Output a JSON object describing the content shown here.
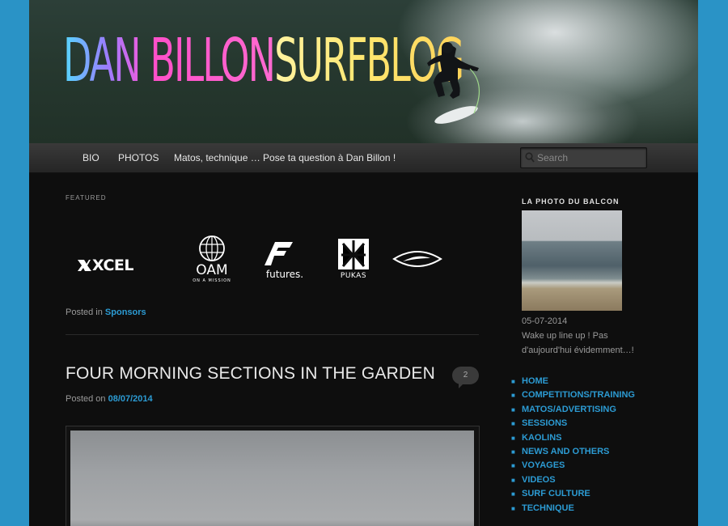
{
  "header": {
    "title_part1": "DAN BILLON",
    "title_part2": " ",
    "title_part3": "SURFBLOG"
  },
  "nav": {
    "items": [
      {
        "label": "BIO"
      },
      {
        "label": "PHOTOS"
      },
      {
        "label": "Matos, technique … Pose ta question à Dan Billon !"
      }
    ],
    "search_placeholder": "Search"
  },
  "featured": {
    "label": "FEATURED",
    "logos": [
      {
        "name": "xcel-logo",
        "text": "XCEL"
      },
      {
        "name": "oam-logo",
        "text": "OAM",
        "subtext": "ON A MISSION"
      },
      {
        "name": "futures-logo",
        "text": "futures."
      },
      {
        "name": "pukas-logo",
        "text": "PUKAS"
      },
      {
        "name": "shaper-logo",
        "text": ""
      }
    ],
    "posted_in_prefix": "Posted in ",
    "posted_in_category": "Sponsors"
  },
  "post": {
    "title": "FOUR MORNING SECTIONS IN THE GARDEN",
    "comment_count": "2",
    "posted_on_prefix": "Posted on ",
    "posted_on_date": "08/07/2014"
  },
  "sidebar": {
    "widget_title": "LA PHOTO DU BALCON",
    "photo_date": "05-07-2014",
    "photo_caption": "Wake up line up ! Pas d'aujourd'hui évidemment…!",
    "menu": [
      "HOME",
      "COMPETITIONS/TRAINING",
      "MATOS/ADVERTISING",
      "SESSIONS",
      "KAOLINS",
      "NEWS AND OTHERS",
      "VOYAGES",
      "VIDEOS",
      "SURF CULTURE",
      "TECHNIQUE"
    ]
  },
  "colors": {
    "page_background": "#2a93c6",
    "content_background": "#0e0e0e",
    "link_blue": "#2c9bd3",
    "nav_background": "#2f2f2f"
  }
}
